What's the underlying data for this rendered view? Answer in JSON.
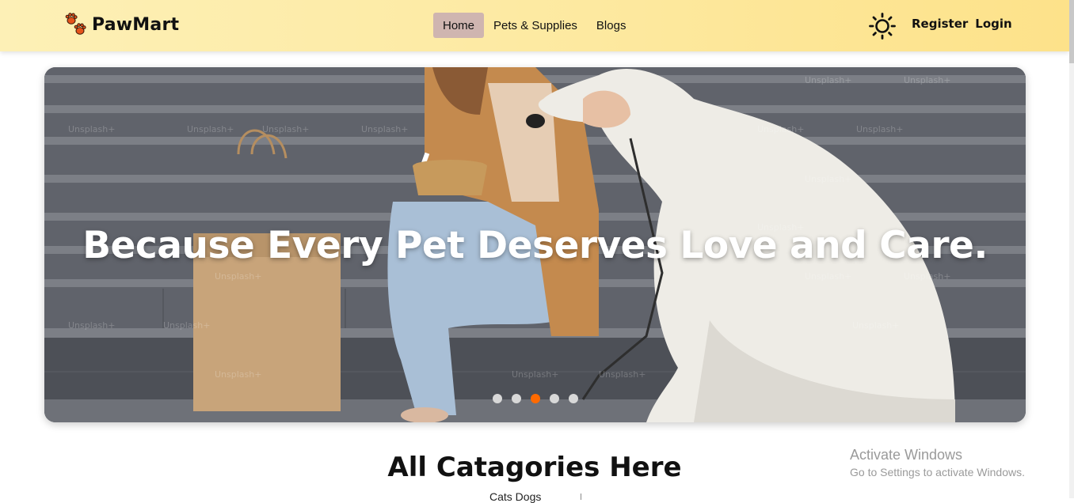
{
  "brand": {
    "name": "PawMart",
    "logo_icon": "paw-prints-icon",
    "accent": "#e5531b"
  },
  "nav": {
    "items": [
      {
        "label": "Home",
        "active": true
      },
      {
        "label": "Pets & Supplies",
        "active": false
      },
      {
        "label": "Blogs",
        "active": false
      }
    ]
  },
  "header_actions": {
    "theme_icon": "sun-icon",
    "register_label": "Register",
    "login_label": "Login"
  },
  "hero": {
    "title": "Because Every Pet Deserves Love and Care.",
    "slide_count": 5,
    "active_slide": 3,
    "active_dot_color": "#ff6a00",
    "watermark": "Unsplash+"
  },
  "categories": {
    "title": "All Catagories Here",
    "subtitle": "Cats  Dogs"
  },
  "windows_notice": {
    "line1": "Activate Windows",
    "line2": "Go to Settings to activate Windows."
  }
}
